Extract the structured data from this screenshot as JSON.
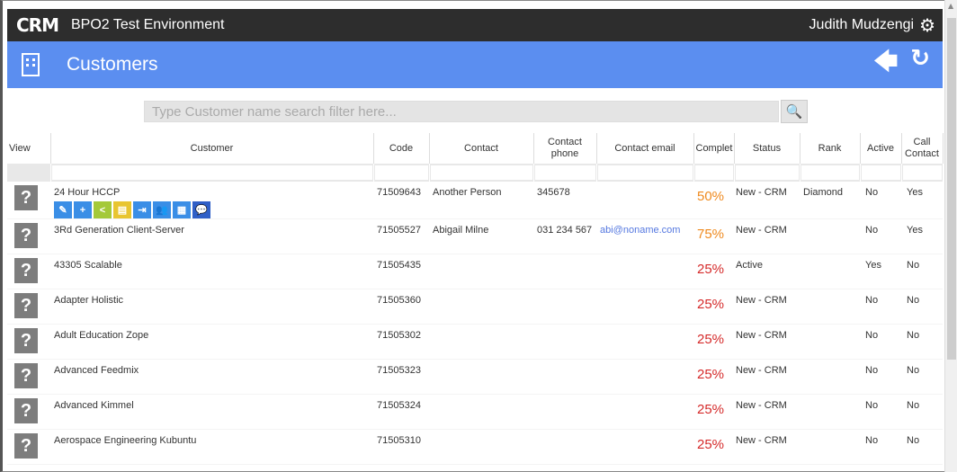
{
  "topbar": {
    "logo": "CRM",
    "app_title": "BPO2 Test Environment",
    "user": "Judith Mudzengi",
    "gear_icon": "gear-icon"
  },
  "header": {
    "title": "Customers",
    "icon": "building-icon",
    "back_icon": "arrow-left-icon",
    "refresh_icon": "refresh-icon"
  },
  "search": {
    "placeholder": "Type Customer name search filter here...",
    "icon": "search-icon"
  },
  "columns": {
    "view": "View",
    "customer": "Customer",
    "code": "Code",
    "contact": "Contact",
    "contact_phone": "Contact phone",
    "contact_email": "Contact email",
    "complete": "Complet",
    "status": "Status",
    "rank": "Rank",
    "active": "Active",
    "call_contact": "Call Contact"
  },
  "rows": [
    {
      "view": "?",
      "customer": "24 Hour HCCP",
      "code": "71509643",
      "contact": "Another Person",
      "phone": "345678",
      "email": "",
      "complete": "50%",
      "status": "New - CRM",
      "rank": "Diamond",
      "active": "No",
      "call": "Yes"
    },
    {
      "view": "?",
      "customer": "3Rd Generation Client-Server",
      "code": "71505527",
      "contact": "Abigail Milne",
      "phone": "031 234 567",
      "email": "abi@noname.com",
      "complete": "75%",
      "status": "New - CRM",
      "rank": "",
      "active": "No",
      "call": "Yes"
    },
    {
      "view": "?",
      "customer": "43305 Scalable",
      "code": "71505435",
      "contact": "",
      "phone": "",
      "email": "",
      "complete": "25%",
      "status": "Active",
      "rank": "",
      "active": "Yes",
      "call": "No"
    },
    {
      "view": "?",
      "customer": "Adapter Holistic",
      "code": "71505360",
      "contact": "",
      "phone": "",
      "email": "",
      "complete": "25%",
      "status": "New - CRM",
      "rank": "",
      "active": "No",
      "call": "No"
    },
    {
      "view": "?",
      "customer": "Adult Education Zope",
      "code": "71505302",
      "contact": "",
      "phone": "",
      "email": "",
      "complete": "25%",
      "status": "New - CRM",
      "rank": "",
      "active": "No",
      "call": "No"
    },
    {
      "view": "?",
      "customer": "Advanced Feedmix",
      "code": "71505323",
      "contact": "",
      "phone": "",
      "email": "",
      "complete": "25%",
      "status": "New - CRM",
      "rank": "",
      "active": "No",
      "call": "No"
    },
    {
      "view": "?",
      "customer": "Advanced Kimmel",
      "code": "71505324",
      "contact": "",
      "phone": "",
      "email": "",
      "complete": "25%",
      "status": "New - CRM",
      "rank": "",
      "active": "No",
      "call": "No"
    },
    {
      "view": "?",
      "customer": "Aerospace Engineering Kubuntu",
      "code": "71505310",
      "contact": "",
      "phone": "",
      "email": "",
      "complete": "25%",
      "status": "New - CRM",
      "rank": "",
      "active": "No",
      "call": "No"
    }
  ],
  "action_icons": [
    {
      "name": "edit-icon",
      "glyph": "✎",
      "color": "#3a8ee6"
    },
    {
      "name": "add-user-icon",
      "glyph": "+",
      "color": "#3a8ee6"
    },
    {
      "name": "share-icon",
      "glyph": "<",
      "color": "#a4c939"
    },
    {
      "name": "document-icon",
      "glyph": "▤",
      "color": "#e8c531"
    },
    {
      "name": "login-icon",
      "glyph": "⇥",
      "color": "#3a8ee6"
    },
    {
      "name": "contacts-icon",
      "glyph": "👥",
      "color": "#3a8ee6"
    },
    {
      "name": "calendar-icon",
      "glyph": "▦",
      "color": "#3a8ee6"
    },
    {
      "name": "chat-icon",
      "glyph": "💬",
      "color": "#2f5fc7"
    }
  ],
  "colors": {
    "topbar": "#2d2d2d",
    "header": "#5b8ef0",
    "pct_orange": "#ef8a1f",
    "pct_red": "#d52a2a",
    "email": "#5578e0"
  }
}
